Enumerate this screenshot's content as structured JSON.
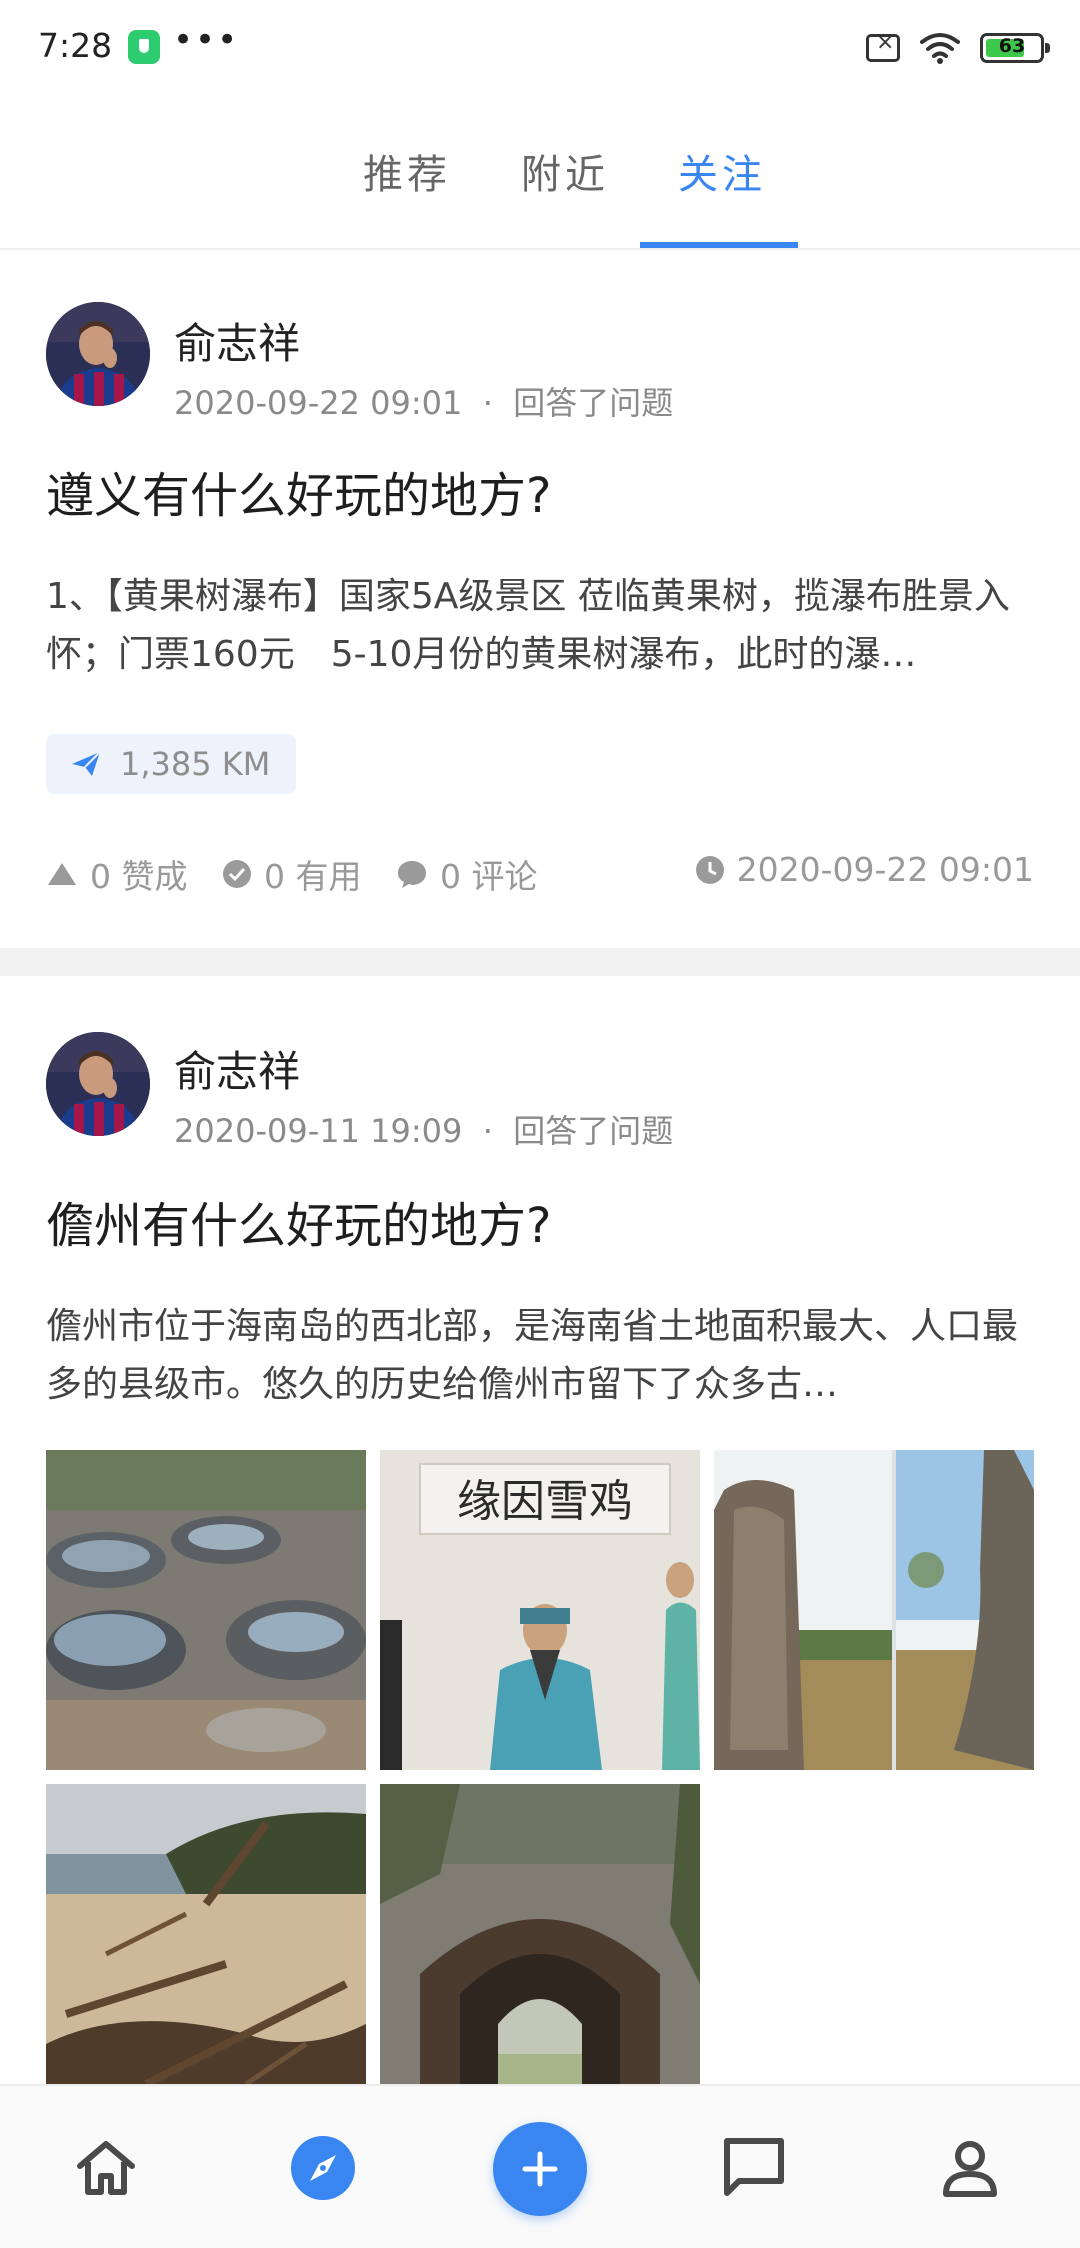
{
  "status_bar": {
    "time": "7:28",
    "more": "•••",
    "battery": "63"
  },
  "tabs": [
    {
      "label": "推荐",
      "active": false
    },
    {
      "label": "附近",
      "active": false
    },
    {
      "label": "关注",
      "active": true
    }
  ],
  "accent_color": "#3a86f0",
  "feed": [
    {
      "author": "俞志祥",
      "date": "2020-09-22 09:01",
      "separator": "·",
      "action": "回答了问题",
      "question": "遵义有什么好玩的地方?",
      "excerpt": "1、【黄果树瀑布】国家5A级景区 莅临黄果树，揽瀑布胜景入怀；门票160元　5-10月份的黄果树瀑布，此时的瀑…",
      "location": "1,385 KM",
      "stats": {
        "likes": "0 赞成",
        "useful": "0 有用",
        "comments": "0 评论",
        "time": "2020-09-22 09:01"
      }
    },
    {
      "author": "俞志祥",
      "date": "2020-09-11 19:09",
      "separator": "·",
      "action": "回答了问题",
      "question": "儋州有什么好玩的地方?",
      "excerpt": "儋州市位于海南岛的西北部，是海南省土地面积最大、人口最多的县级市。悠久的历史给儋州市留下了众多古…",
      "images": [
        "rock-pools-photo",
        "statue-hall-photo",
        "stone-pillars-photo",
        "beach-driftwood-photo",
        "stone-archway-photo"
      ]
    }
  ],
  "bottom_nav": [
    {
      "icon": "home-icon"
    },
    {
      "icon": "compass-icon",
      "active": true
    },
    {
      "icon": "plus-icon"
    },
    {
      "icon": "message-icon"
    },
    {
      "icon": "profile-icon"
    }
  ]
}
